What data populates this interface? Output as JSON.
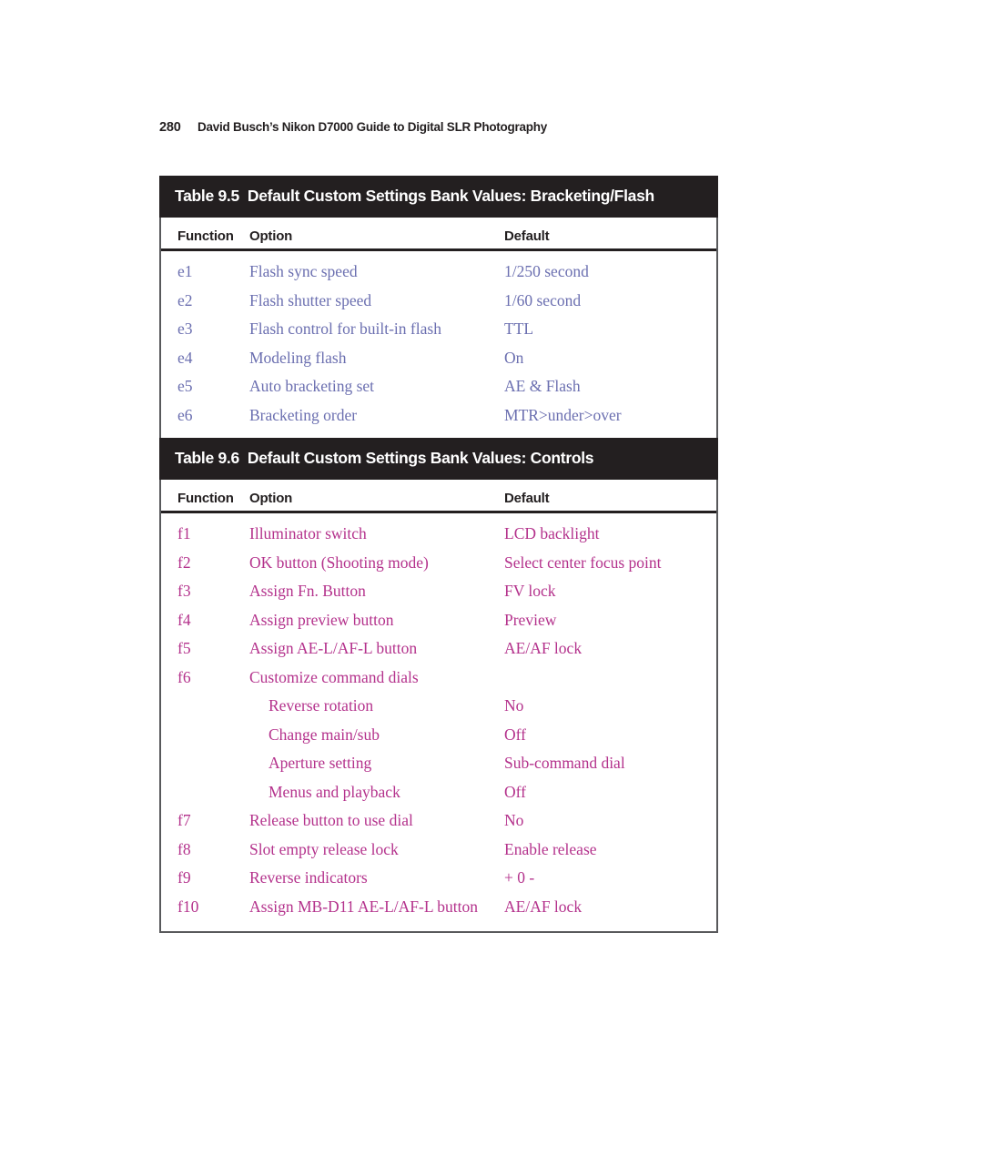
{
  "running_head": {
    "page_number": "280",
    "book_title": "David Busch’s Nikon D7000 Guide to Digital SLR Photography"
  },
  "colors": {
    "caption_background": "#231f20",
    "caption_text": "#ffffff",
    "table_95_text": "#6b6fb0",
    "table_96_text": "#b4328c",
    "border": "#58595b",
    "page_background": "#ffffff"
  },
  "tables": [
    {
      "id": "table-95",
      "caption_number": "Table 9.5",
      "caption_title": "Default Custom Settings Bank Values: Bracketing/Flash",
      "columns": {
        "function": "Function",
        "option": "Option",
        "default": "Default"
      },
      "rows": [
        {
          "function": "e1",
          "option": "Flash sync speed",
          "default": "1/250 second",
          "indent": false
        },
        {
          "function": "e2",
          "option": "Flash shutter speed",
          "default": "1/60 second",
          "indent": false
        },
        {
          "function": "e3",
          "option": "Flash control for built-in flash",
          "default": "TTL",
          "indent": false
        },
        {
          "function": "e4",
          "option": "Modeling flash",
          "default": "On",
          "indent": false
        },
        {
          "function": "e5",
          "option": "Auto bracketing set",
          "default": "AE & Flash",
          "indent": false
        },
        {
          "function": "e6",
          "option": "Bracketing order",
          "default": "MTR>under>over",
          "indent": false
        }
      ]
    },
    {
      "id": "table-96",
      "caption_number": "Table 9.6",
      "caption_title": "Default Custom Settings Bank Values: Controls",
      "columns": {
        "function": "Function",
        "option": "Option",
        "default": "Default"
      },
      "rows": [
        {
          "function": "f1",
          "option": "Illuminator switch",
          "default": "LCD backlight",
          "indent": false
        },
        {
          "function": "f2",
          "option": "OK button (Shooting mode)",
          "default": "Select center focus point",
          "indent": false
        },
        {
          "function": "f3",
          "option": "Assign Fn. Button",
          "default": "FV lock",
          "indent": false
        },
        {
          "function": "f4",
          "option": "Assign preview button",
          "default": "Preview",
          "indent": false
        },
        {
          "function": "f5",
          "option": "Assign AE-L/AF-L button",
          "default": "AE/AF lock",
          "indent": false
        },
        {
          "function": "f6",
          "option": "Customize command dials",
          "default": "",
          "indent": false
        },
        {
          "function": "",
          "option": "Reverse rotation",
          "default": "No",
          "indent": true
        },
        {
          "function": "",
          "option": "Change main/sub",
          "default": "Off",
          "indent": true
        },
        {
          "function": "",
          "option": "Aperture setting",
          "default": "Sub-command dial",
          "indent": true
        },
        {
          "function": "",
          "option": "Menus and playback",
          "default": "Off",
          "indent": true
        },
        {
          "function": "f7",
          "option": "Release button to use dial",
          "default": "No",
          "indent": false
        },
        {
          "function": "f8",
          "option": "Slot empty release lock",
          "default": "Enable release",
          "indent": false
        },
        {
          "function": "f9",
          "option": "Reverse indicators",
          "default": "+ 0 -",
          "indent": false
        },
        {
          "function": "f10",
          "option": "Assign MB-D11 AE-L/AF-L button",
          "default": "AE/AF lock",
          "indent": false
        }
      ]
    }
  ]
}
